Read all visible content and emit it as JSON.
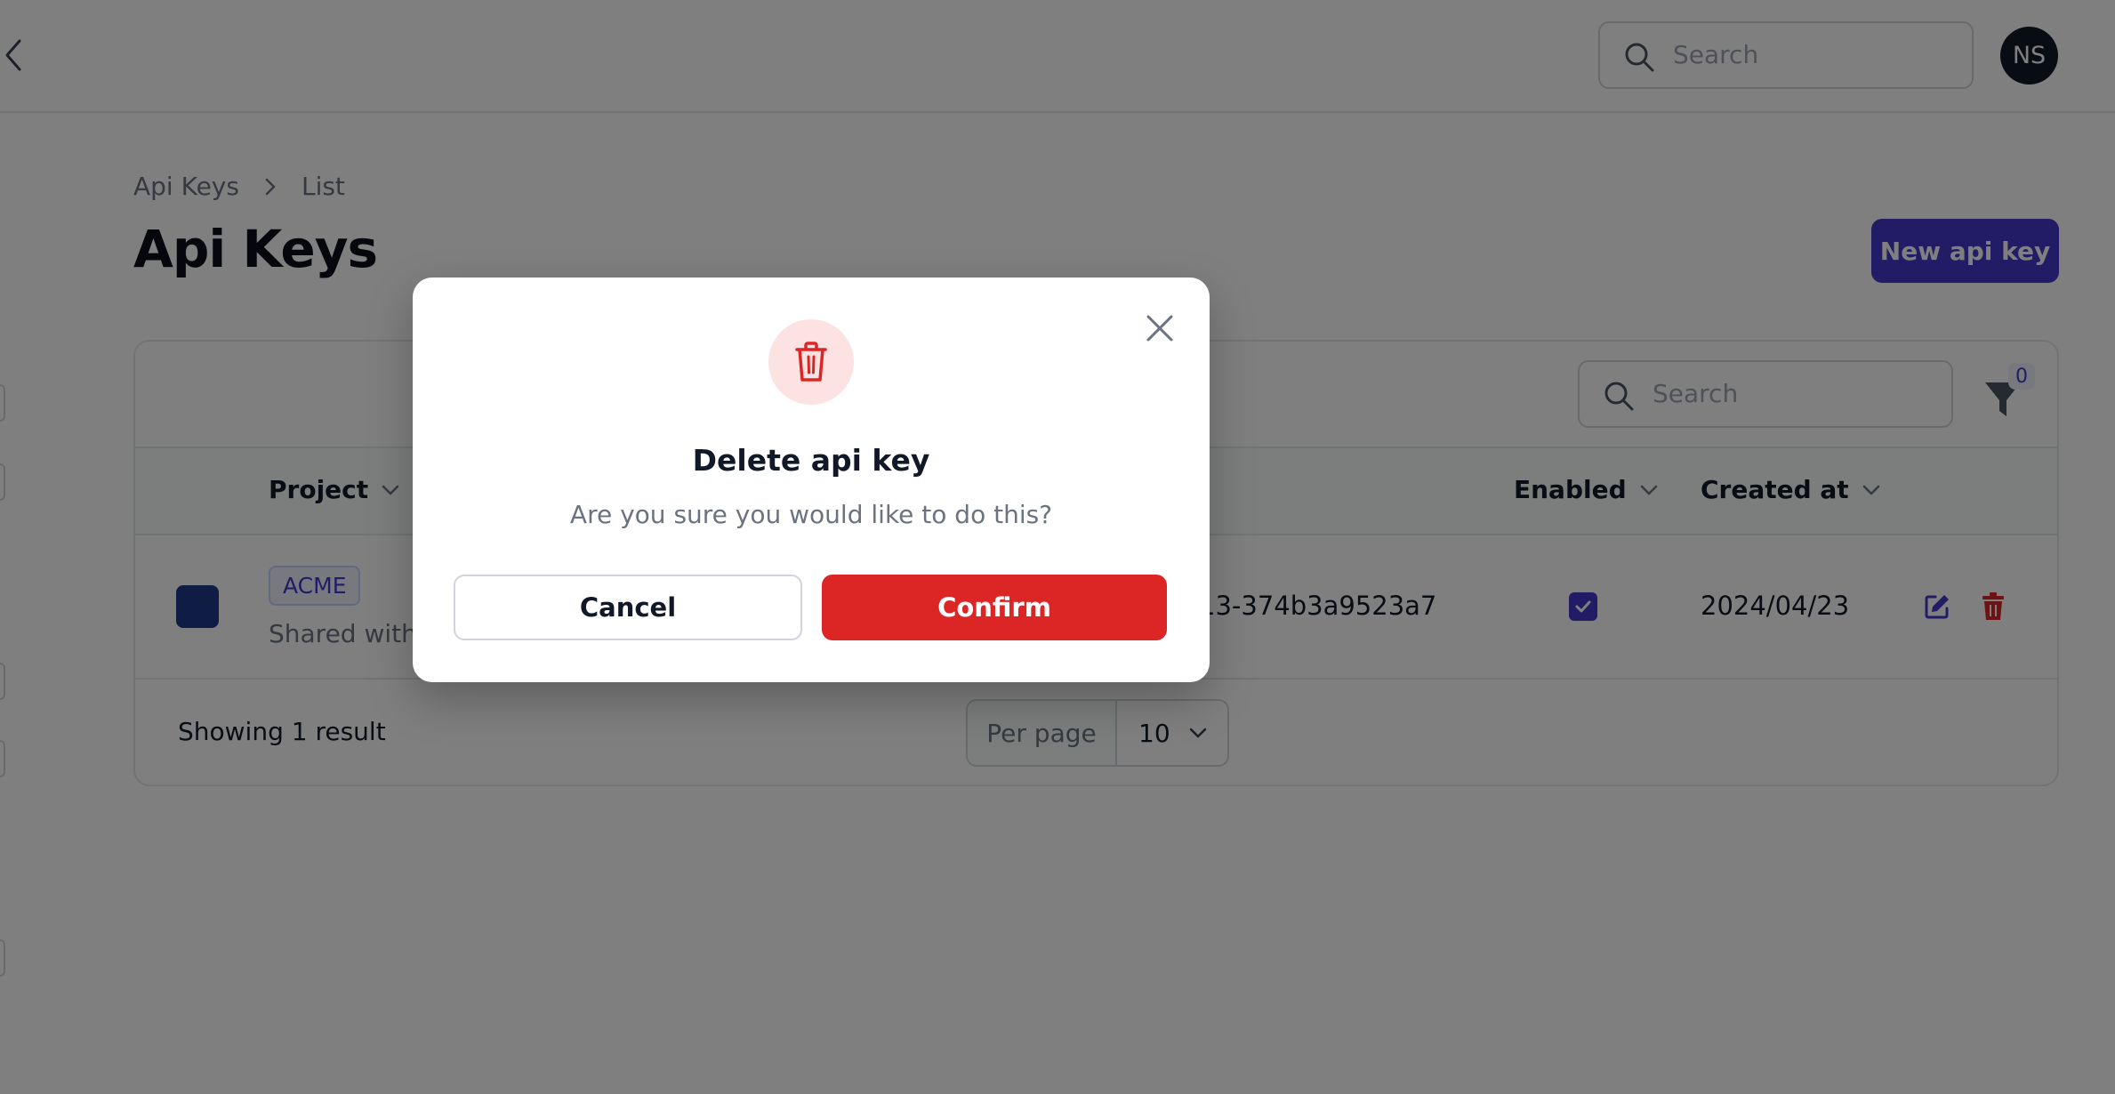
{
  "topbar": {
    "search_placeholder": "Search",
    "avatar_initials": "NS"
  },
  "breadcrumb": [
    "Api Keys",
    "List"
  ],
  "page_title": "Api Keys",
  "actions": {
    "new_label": "New api key"
  },
  "table": {
    "search_placeholder": "Search",
    "filter_count": "0",
    "columns": [
      "Project",
      "Enabled",
      "Created at"
    ],
    "rows": [
      {
        "project": "ACME",
        "shared": "Shared with",
        "key": "13-374b3a9523a7",
        "enabled": true,
        "created_at": "2024/04/23"
      }
    ],
    "footer": {
      "showing": "Showing 1 result",
      "per_page_label": "Per page",
      "per_page_value": "10"
    }
  },
  "modal": {
    "title": "Delete api key",
    "description": "Are you sure you would like to do this?",
    "cancel_label": "Cancel",
    "confirm_label": "Confirm"
  },
  "colors": {
    "primary": "#4338ca",
    "danger": "#dc2626",
    "overlay": "rgba(0,0,0,0.5)"
  }
}
